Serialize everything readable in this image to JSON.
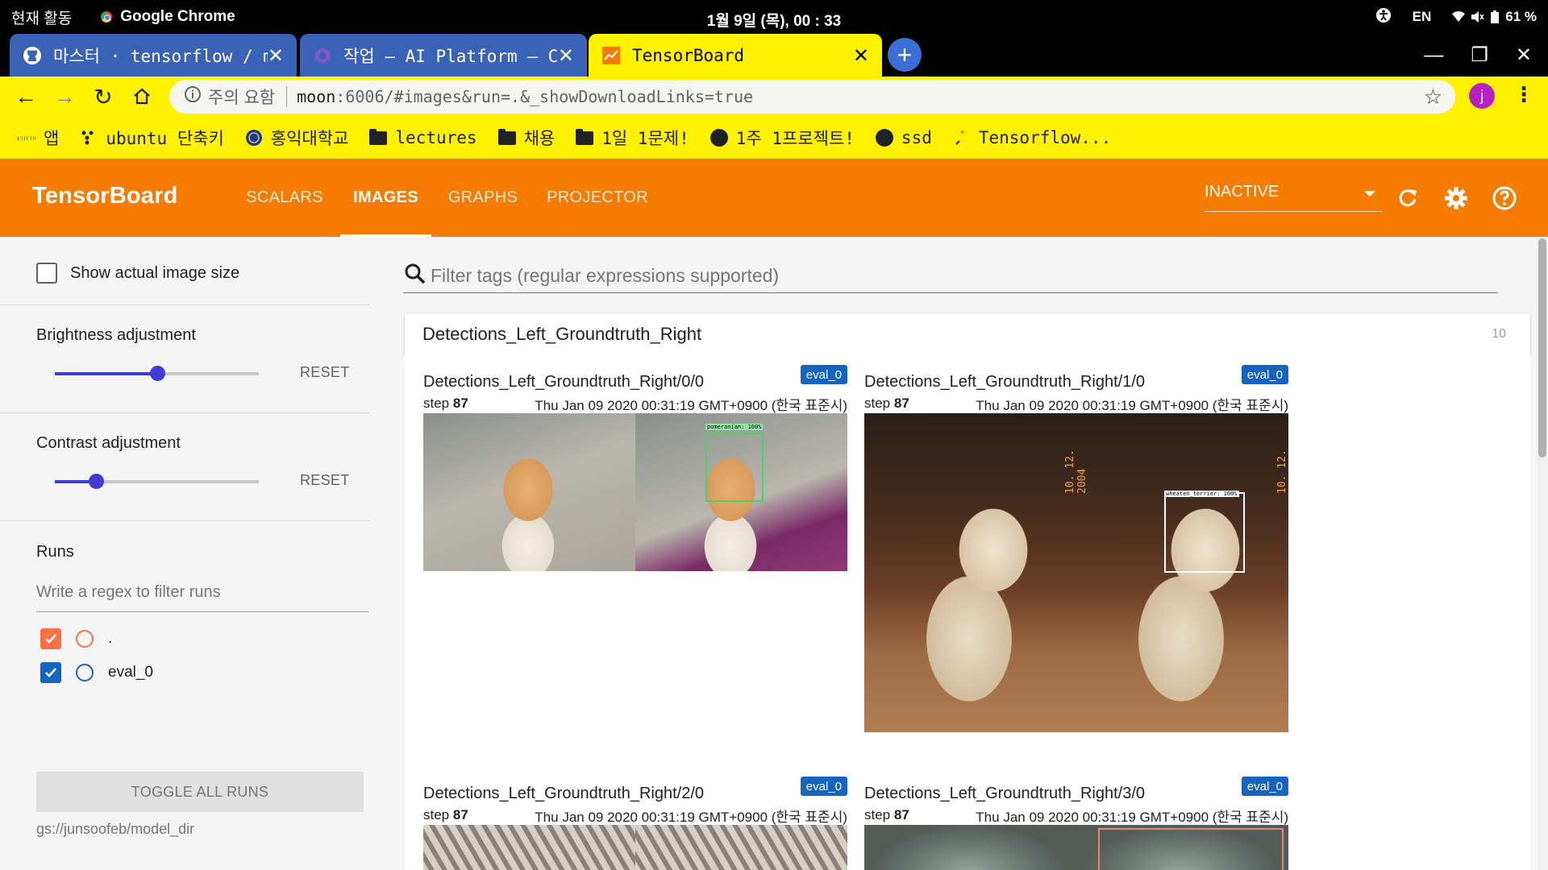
{
  "os": {
    "activities": "현재 활동",
    "app_name": "Google Chrome",
    "clock": "1월 9일 (목), 00 : 33",
    "lang": "EN",
    "battery": "61 %"
  },
  "tabs": [
    {
      "title": "마스터 · tensorflow / m",
      "favicon": "github-icon",
      "active": false
    },
    {
      "title": "작업 – AI Platform – C",
      "favicon": "ai-platform-icon",
      "active": false
    },
    {
      "title": "TensorBoard",
      "favicon": "tensorboard-icon",
      "active": true
    }
  ],
  "address": {
    "security_label": "주의 요함",
    "url_host": "moon",
    "url_rest": ":6006/#images&run=.&_showDownloadLinks=true",
    "avatar_letter": "j"
  },
  "bookmarks": [
    {
      "label": "앱",
      "icon": "apps-grid-icon"
    },
    {
      "label": "ubuntu 단축키",
      "icon": "dots-icon"
    },
    {
      "label": "홍익대학교",
      "icon": "seal-icon"
    },
    {
      "label": "lectures",
      "icon": "folder-icon"
    },
    {
      "label": "채용",
      "icon": "folder-icon"
    },
    {
      "label": "1일 1문제!",
      "icon": "folder-icon"
    },
    {
      "label": "1주 1프로젝트!",
      "icon": "github-icon"
    },
    {
      "label": "ssd",
      "icon": "github-icon"
    },
    {
      "label": "Tensorflow...",
      "icon": "tensorflow-icon"
    }
  ],
  "tb": {
    "logo": "TensorBoard",
    "tabs": [
      "SCALARS",
      "IMAGES",
      "GRAPHS",
      "PROJECTOR"
    ],
    "active_tab": "IMAGES",
    "status": "INACTIVE"
  },
  "sidebar": {
    "show_actual_size": "Show actual image size",
    "show_actual_size_checked": false,
    "brightness_label": "Brightness adjustment",
    "brightness_value": 0.5,
    "contrast_label": "Contrast adjustment",
    "contrast_value": 0.2,
    "reset": "RESET",
    "runs_label": "Runs",
    "runs_filter_placeholder": "Write a regex to filter runs",
    "runs": [
      {
        "name": ".",
        "checked": true,
        "color": "#ff7043"
      },
      {
        "name": "eval_0",
        "checked": true,
        "color": "#1565c0"
      }
    ],
    "toggle_all": "TOGGLE ALL RUNS",
    "logdir": "gs://junsoofeb/model_dir"
  },
  "main": {
    "filter_placeholder": "Filter tags (regular expressions supported)",
    "section_title": "Detections_Left_Groundtruth_Right",
    "section_count": "10",
    "images": [
      {
        "tag": "Detections_Left_Groundtruth_Right/0/0",
        "run": "eval_0",
        "step_label": "step",
        "step": "87",
        "time": "Thu Jan 09 2020 00:31:19 GMT+0900 (한국 표준시)",
        "detection_label": "pomeranian: 100%"
      },
      {
        "tag": "Detections_Left_Groundtruth_Right/1/0",
        "run": "eval_0",
        "step_label": "step",
        "step": "87",
        "time": "Thu Jan 09 2020 00:31:19 GMT+0900 (한국 표준시)",
        "detection_label": "wheaten_terrier: 100%",
        "photo_stamp": "10. 12. 2004"
      },
      {
        "tag": "Detections_Left_Groundtruth_Right/2/0",
        "run": "eval_0",
        "step_label": "step",
        "step": "87",
        "time": "Thu Jan 09 2020 00:31:19 GMT+0900 (한국 표준시)"
      },
      {
        "tag": "Detections_Left_Groundtruth_Right/3/0",
        "run": "eval_0",
        "step_label": "step",
        "step": "87",
        "time": "Thu Jan 09 2020 00:31:19 GMT+0900 (한국 표준시)"
      }
    ]
  }
}
